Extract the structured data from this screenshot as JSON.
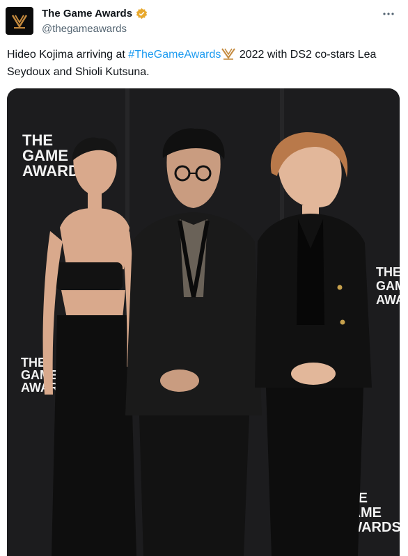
{
  "account": {
    "display_name": "The Game Awards",
    "handle": "@thegameawards",
    "verified_color": "#e8a92e"
  },
  "tweet": {
    "text_before": "Hideo Kojima arriving at ",
    "hashtag": "#TheGameAwards",
    "text_after": " 2022 with DS2 co-stars Lea Seydoux and Shioli Kutsuna."
  },
  "photo": {
    "backdrop_logos": [
      {
        "line1": "THE",
        "line2": "GAME",
        "line3": "AWARDS"
      },
      {
        "line1": "THE",
        "line2": "GAME",
        "line3": "AWARDS"
      },
      {
        "line1": "THE",
        "line2": "GAME",
        "line3": "AWARDS"
      },
      {
        "line1": "THE",
        "line2": "GAME",
        "line3": "AWARDS"
      }
    ],
    "colors": {
      "backdrop": "#1c1c1e",
      "accent": "#c48a3e"
    }
  },
  "icons": {
    "more": "more-icon",
    "verified": "verified-badge-icon",
    "logo": "tga-logo-icon",
    "emoji": "trophy-emoji-icon"
  }
}
